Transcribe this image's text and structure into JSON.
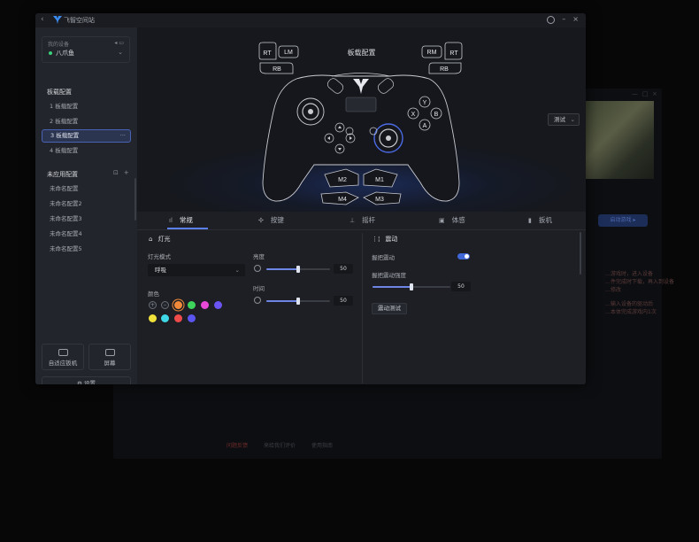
{
  "background_window": {
    "title_chars": [
      "—",
      "□",
      "×"
    ],
    "game_button": "启动游戏  ▸",
    "side_texts": [
      "…游戏时，进入设备",
      "…件完成时下载，再入到设备",
      "…修改",
      "…输入设备的驱动后",
      "…本体完成游戏内1次"
    ],
    "footer": {
      "left": "问题反馈",
      "middle": "来给我们评价",
      "right": "使用指南"
    }
  },
  "titlebar": {
    "app_name": "飞智空间站",
    "back_icon": "‹",
    "minimize": "–",
    "close": "×"
  },
  "device": {
    "label": "我的设备",
    "name": "八爪鱼",
    "battery": "◂ ▭"
  },
  "sidebar": {
    "configs_title": "板载配置",
    "configs": [
      {
        "label": "1  板载配置"
      },
      {
        "label": "2  板载配置"
      },
      {
        "label": "3  板载配置",
        "more": "···"
      },
      {
        "label": "4  板载配置"
      }
    ],
    "unapplied_title": "未应用配置",
    "unapplied": [
      "未命名配置",
      "未命名配置2",
      "未命名配置3",
      "未命名配置4",
      "未命名配置5"
    ],
    "bottom": {
      "adaptive": "自适应扳机",
      "screen": "屏幕",
      "settings": "设置"
    }
  },
  "stage": {
    "title": "板载配置",
    "test_label": "测试",
    "buttons": {
      "rt_left": "RT",
      "lm": "LM",
      "rb_left": "RB",
      "rm": "RM",
      "rt_right": "RT",
      "rb_right": "RB",
      "y": "Y",
      "x": "X",
      "b": "B",
      "a": "A",
      "m1": "M1",
      "m2": "M2",
      "m3": "M3",
      "m4": "M4"
    }
  },
  "tabs": [
    {
      "label": "常规",
      "active": true
    },
    {
      "label": "按键"
    },
    {
      "label": "摇杆"
    },
    {
      "label": "体感"
    },
    {
      "label": "扳机"
    }
  ],
  "light": {
    "title": "灯光",
    "mode_label": "灯光模式",
    "mode_value": "呼吸",
    "color_label": "颜色",
    "colors": [
      "#f08a3a",
      "#3ed35a",
      "#e848d8",
      "#6a54f2",
      "#f0e23a",
      "#3ed8e6",
      "#ef4b4b",
      "#5b55f0"
    ],
    "brightness_label": "亮度",
    "brightness_value": "50",
    "time_label": "时间",
    "time_value": "50",
    "add_symbol": "+",
    "remove_symbol": "–"
  },
  "vibration": {
    "title": "震动",
    "toggle_label": "握把震动",
    "toggle_on": true,
    "strength_label": "握把震动强度",
    "strength_value": "50",
    "test_button": "震动测试"
  },
  "accent": "#5c7ff0"
}
